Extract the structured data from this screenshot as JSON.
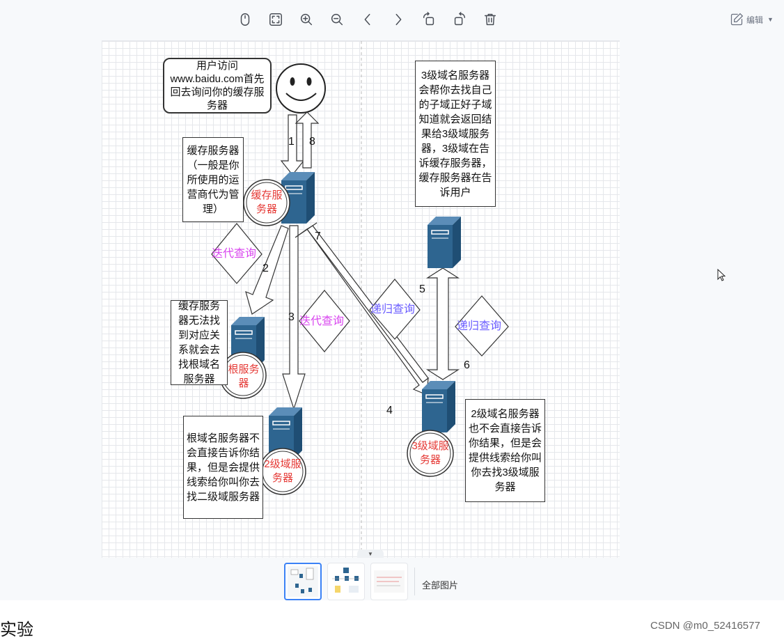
{
  "toolbar": {
    "buttons": [
      {
        "name": "mouse-mode-button",
        "icon": "mouse-icon"
      },
      {
        "name": "fit-screen-button",
        "icon": "fit-screen-icon"
      },
      {
        "name": "zoom-in-button",
        "icon": "zoom-in-icon"
      },
      {
        "name": "zoom-out-button",
        "icon": "zoom-out-icon"
      },
      {
        "name": "previous-button",
        "icon": "chevron-left-icon"
      },
      {
        "name": "next-button",
        "icon": "chevron-right-icon"
      },
      {
        "name": "rotate-left-button",
        "icon": "rotate-left-icon"
      },
      {
        "name": "rotate-right-button",
        "icon": "rotate-right-icon"
      },
      {
        "name": "delete-button",
        "icon": "trash-icon"
      }
    ],
    "edit_label": "编辑"
  },
  "diagram": {
    "notes": {
      "user_visit": "用户访问www.baidu.com首先回去询问你的缓存服务器",
      "cache_desc": "缓存服务器（一般是你所使用的运营商代为管理）",
      "cache_nofind": "缓存服务器无法找到对应关系就会去找根域名服务器",
      "root_desc": "根域名服务器不会直接告诉你结果，但是会提供线索给你叫你去找二级域服务器",
      "third_desc": "3级域名服务器会帮你去找自己的子域正好子域知道就会返回结果给3级域服务器，3级域在告诉缓存服务器，缓存服务器在告诉用户",
      "second_desc": "2级域名服务器也不会直接告诉你结果，但是会提供线索给你叫你去找3级域服务器"
    },
    "servers": {
      "cache": "缓存服务器",
      "root": "根服务器",
      "second": "2级域服务器",
      "third": "3级域服务器"
    },
    "query_labels": {
      "iterative_1": "迭代查询",
      "iterative_2": "迭代查询",
      "recursive_1": "递归查询",
      "recursive_2": "递归查询"
    },
    "step_numbers": [
      "1",
      "8",
      "2",
      "3",
      "7",
      "4",
      "5",
      "6"
    ]
  },
  "thumbnails": {
    "all_images_label": "全部图片"
  },
  "page": {
    "section_text": "实验",
    "watermark": "CSDN @m0_52416577"
  },
  "colors": {
    "server_blue": "#2e6590",
    "red_label": "#e53935",
    "iterative_purple": "#d946ef",
    "recursive_blue": "#6a5cff",
    "accent_blue": "#3b82f6"
  }
}
